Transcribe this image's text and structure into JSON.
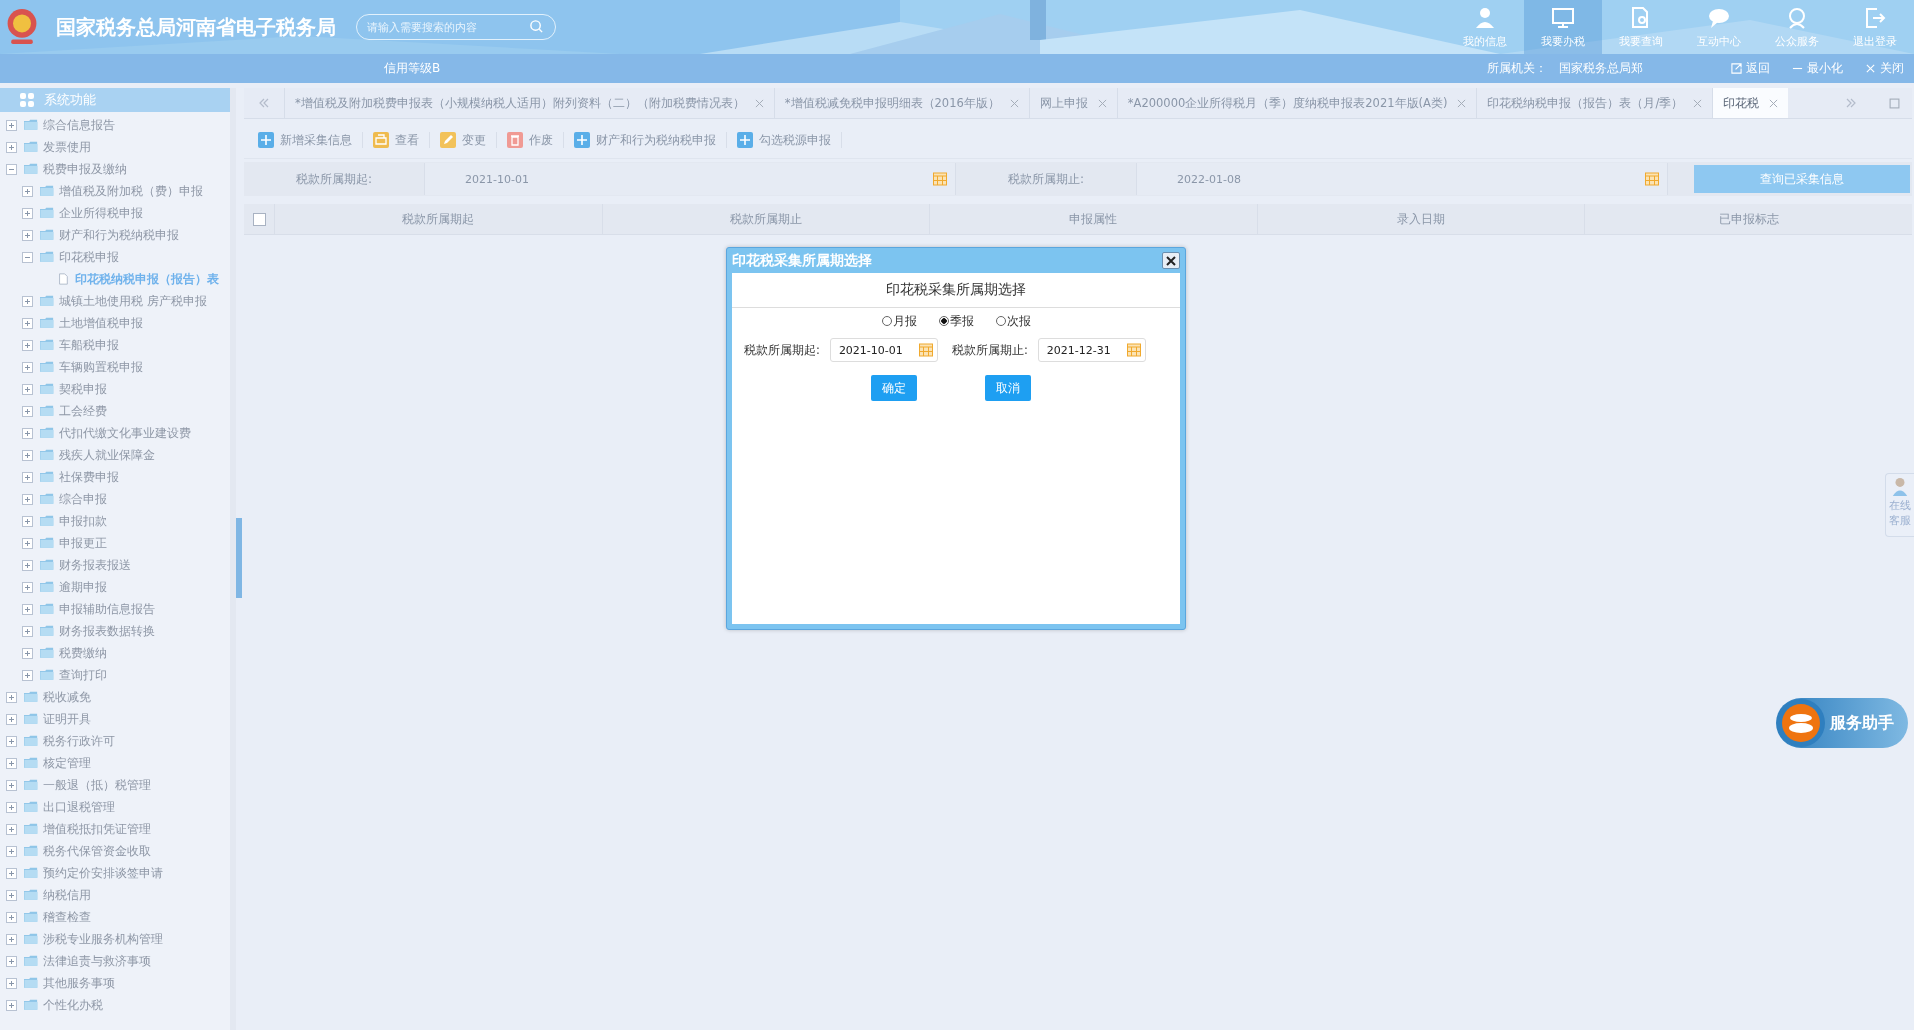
{
  "header": {
    "site_title": "国家税务总局河南省电子税务局",
    "search": {
      "placeholder": "请输入需要搜索的内容"
    },
    "nav": [
      {
        "label": "我的信息",
        "kind": "user",
        "selected": false
      },
      {
        "label": "我要办税",
        "kind": "monitor",
        "selected": true
      },
      {
        "label": "我要查询",
        "kind": "query",
        "selected": false
      },
      {
        "label": "互动中心",
        "kind": "chat",
        "selected": false
      },
      {
        "label": "公众服务",
        "kind": "service",
        "selected": false
      },
      {
        "label": "退出登录",
        "kind": "logout",
        "selected": false
      }
    ]
  },
  "info_bar": {
    "credit": "信用等级B",
    "authority_label": "所属机关：",
    "authority": "国家税务总局郑",
    "actions": [
      {
        "label": "返回",
        "kind": "back"
      },
      {
        "label": "最小化",
        "kind": "minimize"
      },
      {
        "label": "关闭",
        "kind": "close"
      }
    ]
  },
  "sidebar": {
    "title": "系统功能",
    "items": [
      {
        "label": "综合信息报告",
        "expanded": false,
        "selected": false
      },
      {
        "label": "发票使用",
        "expanded": false,
        "selected": false
      },
      {
        "label": "税费申报及缴纳",
        "expanded": true,
        "selected": false,
        "children": [
          {
            "label": "增值税及附加税（费）申报",
            "expanded": false,
            "selected": false
          },
          {
            "label": "企业所得税申报",
            "expanded": false,
            "selected": false
          },
          {
            "label": "财产和行为税纳税申报",
            "expanded": false,
            "selected": false
          },
          {
            "label": "印花税申报",
            "expanded": true,
            "selected": false,
            "children": [
              {
                "label": "印花税纳税申报（报告）表",
                "kind": "page",
                "selected": true
              }
            ]
          },
          {
            "label": "城镇土地使用税 房产税申报",
            "expanded": false,
            "selected": false
          },
          {
            "label": "土地增值税申报",
            "expanded": false,
            "selected": false
          },
          {
            "label": "车船税申报",
            "expanded": false,
            "selected": false
          },
          {
            "label": "车辆购置税申报",
            "expanded": false,
            "selected": false
          },
          {
            "label": "契税申报",
            "expanded": false,
            "selected": false
          },
          {
            "label": "工会经费",
            "expanded": false,
            "selected": false
          },
          {
            "label": "代扣代缴文化事业建设费",
            "expanded": false,
            "selected": false
          },
          {
            "label": "残疾人就业保障金",
            "expanded": false,
            "selected": false
          },
          {
            "label": "社保费申报",
            "expanded": false,
            "selected": false
          },
          {
            "label": "综合申报",
            "expanded": false,
            "selected": false
          },
          {
            "label": "申报扣款",
            "expanded": false,
            "selected": false
          },
          {
            "label": "申报更正",
            "expanded": false,
            "selected": false
          },
          {
            "label": "财务报表报送",
            "expanded": false,
            "selected": false
          },
          {
            "label": "逾期申报",
            "expanded": false,
            "selected": false
          },
          {
            "label": "申报辅助信息报告",
            "expanded": false,
            "selected": false
          },
          {
            "label": "财务报表数据转换",
            "expanded": false,
            "selected": false
          },
          {
            "label": "税费缴纳",
            "expanded": false,
            "selected": false
          },
          {
            "label": "查询打印",
            "expanded": false,
            "selected": false
          }
        ]
      },
      {
        "label": "税收减免",
        "expanded": false,
        "selected": false
      },
      {
        "label": "证明开具",
        "expanded": false,
        "selected": false
      },
      {
        "label": "税务行政许可",
        "expanded": false,
        "selected": false
      },
      {
        "label": "核定管理",
        "expanded": false,
        "selected": false
      },
      {
        "label": "一般退（抵）税管理",
        "expanded": false,
        "selected": false
      },
      {
        "label": "出口退税管理",
        "expanded": false,
        "selected": false
      },
      {
        "label": "增值税抵扣凭证管理",
        "expanded": false,
        "selected": false
      },
      {
        "label": "税务代保管资金收取",
        "expanded": false,
        "selected": false
      },
      {
        "label": "预约定价安排谈签申请",
        "expanded": false,
        "selected": false
      },
      {
        "label": "纳税信用",
        "expanded": false,
        "selected": false
      },
      {
        "label": "稽查检查",
        "expanded": false,
        "selected": false
      },
      {
        "label": "涉税专业服务机构管理",
        "expanded": false,
        "selected": false
      },
      {
        "label": "法律追责与救济事项",
        "expanded": false,
        "selected": false
      },
      {
        "label": "其他服务事项",
        "expanded": false,
        "selected": false
      },
      {
        "label": "个性化办税",
        "expanded": false,
        "selected": false
      }
    ]
  },
  "tabs": [
    {
      "label": "*增值税及附加税费申报表（小规模纳税人适用）附列资料（二）（附加税费情况表）",
      "selected": false
    },
    {
      "label": "*增值税减免税申报明细表（2016年版）",
      "selected": false
    },
    {
      "label": "网上申报",
      "selected": false
    },
    {
      "label": "*A200000企业所得税月（季）度纳税申报表2021年版(A类)",
      "selected": false
    },
    {
      "label": "印花税纳税申报（报告）表（月/季）",
      "selected": false
    },
    {
      "label": "印花税",
      "selected": true
    }
  ],
  "toolbar": [
    {
      "label": "新增采集信息",
      "kind": "add"
    },
    {
      "label": "查看",
      "kind": "view"
    },
    {
      "label": "变更",
      "kind": "edit"
    },
    {
      "label": "作废",
      "kind": "void"
    },
    {
      "label": "财产和行为税纳税申报",
      "kind": "add"
    },
    {
      "label": "勾选税源申报",
      "kind": "add"
    }
  ],
  "filter": {
    "start_label": "税款所属期起:",
    "start": "2021-10-01",
    "end_label": "税款所属期止:",
    "end": "2022-01-08",
    "query_button": "查询已采集信息"
  },
  "table": {
    "select_all_checked": false,
    "columns": [
      "税款所属期起",
      "税款所属期止",
      "申报属性",
      "录入日期",
      "已申报标志"
    ]
  },
  "dialog": {
    "title": "印花税采集所属期选择",
    "heading": "印花税采集所属期选择",
    "periods": [
      {
        "label": "月报",
        "selected": false
      },
      {
        "label": "季报",
        "selected": true
      },
      {
        "label": "次报",
        "selected": false
      }
    ],
    "start_label": "税款所属期起:",
    "start": "2021-10-01",
    "end_label": "税款所属期止:",
    "end": "2021-12-31",
    "buttons": [
      {
        "label": "确定"
      },
      {
        "label": "取消"
      }
    ]
  },
  "online_service": {
    "line_1": "在线",
    "line_2": "客服"
  },
  "assistant": {
    "label": "服务助手"
  }
}
